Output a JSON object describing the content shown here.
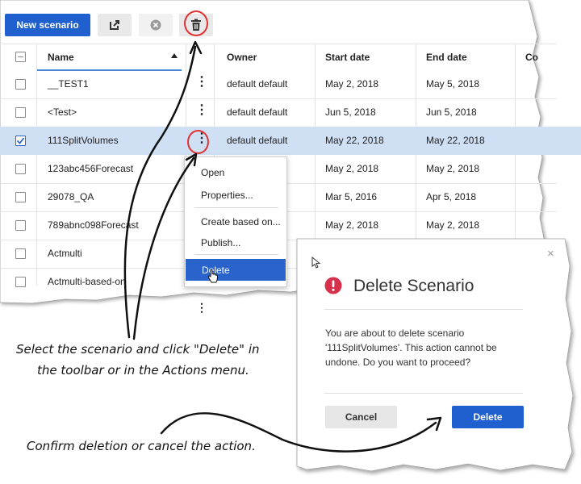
{
  "toolbar": {
    "new_scenario_label": "New scenario"
  },
  "table": {
    "columns": [
      "Name",
      "Owner",
      "Start date",
      "End date",
      "Co"
    ],
    "rows": [
      {
        "name": "__TEST1",
        "owner": "default default",
        "start": "May 2, 2018",
        "end": "May 5, 2018",
        "checked": false
      },
      {
        "name": "<Test>",
        "owner": "default default",
        "start": "Jun 5, 2018",
        "end": "Jun 5, 2018",
        "checked": false
      },
      {
        "name": "111SplitVolumes",
        "owner": "default default",
        "start": "May 22, 2018",
        "end": "May 22, 2018",
        "checked": true
      },
      {
        "name": "123abc456Forecast",
        "owner": "",
        "start": "May 2, 2018",
        "end": "May 2, 2018",
        "checked": false
      },
      {
        "name": "29078_QA",
        "owner": "",
        "start": "Mar 5, 2016",
        "end": "Apr 5, 2018",
        "checked": false
      },
      {
        "name": "789abnc098Forecast",
        "owner": "",
        "start": "May 2, 2018",
        "end": "May 2, 2018",
        "checked": false
      },
      {
        "name": "Actmulti",
        "owner": "",
        "start": "",
        "end": "",
        "checked": false
      },
      {
        "name": "Actmulti-based-on",
        "owner": "",
        "start": "",
        "end": "",
        "checked": false
      }
    ]
  },
  "context_menu": {
    "items": [
      "Open",
      "Properties...",
      "Create based on...",
      "Publish...",
      "Delete"
    ]
  },
  "dialog": {
    "title": "Delete Scenario",
    "message": "You are about to delete scenario '111SplitVolumes'. This action cannot be undone. Do you want to proceed?",
    "cancel_label": "Cancel",
    "delete_label": "Delete",
    "close_glyph": "×"
  },
  "captions": {
    "line1": "Select the scenario and click \"Delete\" in",
    "line2": "the toolbar or in the Actions menu.",
    "line3": "Confirm deletion or cancel the action."
  },
  "colors": {
    "primary": "#1f5fce",
    "selected_row": "#cfe0f5",
    "highlight_ring": "#e03232",
    "alert_icon": "#d7304a"
  },
  "icons": {
    "open_external": "open-external-icon",
    "cancel": "cancel-circle-icon",
    "trash": "trash-icon",
    "kebab": "kebab-menu-icon",
    "alert": "alert-circle-icon",
    "cursor": "mouse-pointer-icon",
    "hand": "hand-pointer-icon"
  }
}
